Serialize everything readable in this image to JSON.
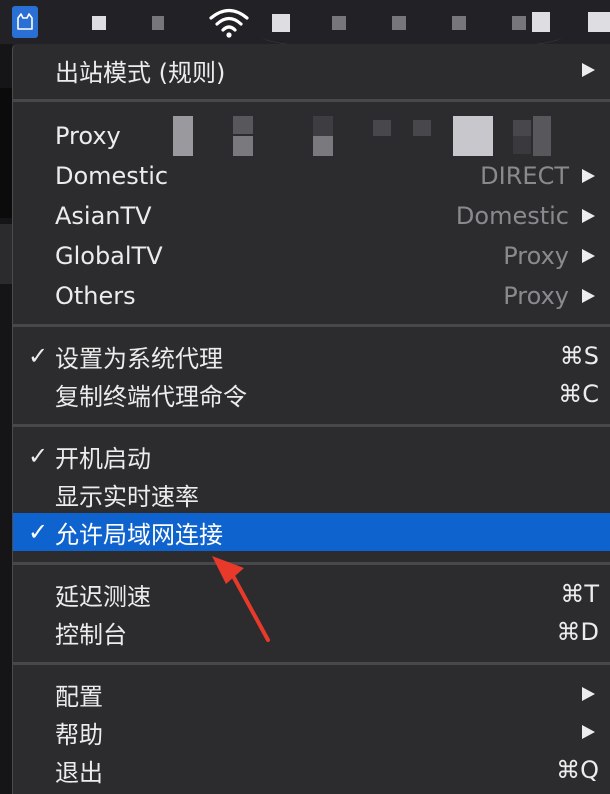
{
  "menu": {
    "outbound_mode": "出站模式 (规则)",
    "groups": [
      {
        "label": "Proxy",
        "value": ""
      },
      {
        "label": "Domestic",
        "value": "DIRECT"
      },
      {
        "label": "AsianTV",
        "value": "Domestic"
      },
      {
        "label": "GlobalTV",
        "value": "Proxy"
      },
      {
        "label": "Others",
        "value": "Proxy"
      }
    ],
    "system_proxy": {
      "label": "设置为系统代理",
      "shortcut": "⌘S",
      "checked": true
    },
    "copy_command": {
      "label": "复制终端代理命令",
      "shortcut": "⌘C"
    },
    "launch_at_login": {
      "label": "开机启动",
      "checked": true
    },
    "show_speed": {
      "label": "显示实时速率"
    },
    "allow_lan": {
      "label": "允许局域网连接",
      "checked": true,
      "selected": true
    },
    "latency_test": {
      "label": "延迟测速",
      "shortcut": "⌘T"
    },
    "console": {
      "label": "控制台",
      "shortcut": "⌘D"
    },
    "config": {
      "label": "配置"
    },
    "help": {
      "label": "帮助"
    },
    "quit": {
      "label": "退出",
      "shortcut": "⌘Q"
    }
  },
  "colors": {
    "menu_bg": "#2c2c2e",
    "highlight": "#0f63ce",
    "secondary_text": "#8a8a8e",
    "annotation_arrow": "#e8392b"
  },
  "icons": {
    "app": "cat-icon",
    "wifi": "wifi-icon",
    "check": "✓",
    "submenu": "triangle-right-icon"
  }
}
